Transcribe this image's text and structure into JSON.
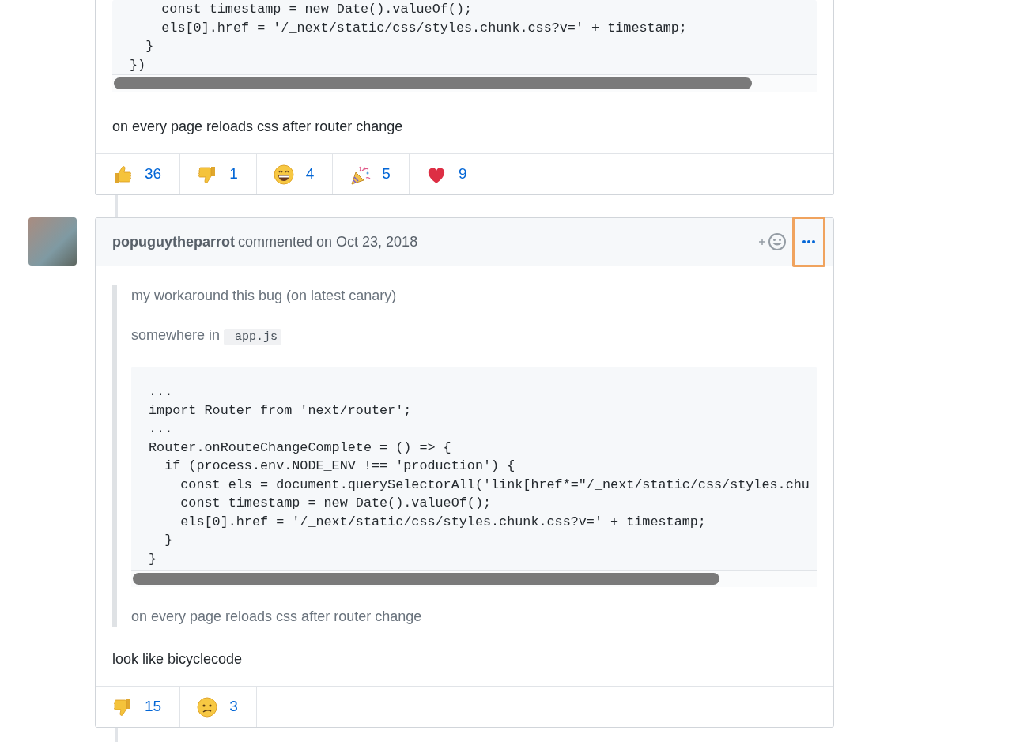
{
  "comments": [
    {
      "code_lines": [
        "    const timestamp = new Date().valueOf();",
        "    els[0].href = '/_next/static/css/styles.chunk.css?v=' + timestamp;",
        "  }",
        "})"
      ],
      "body": "on every page reloads css after router change",
      "reactions": [
        {
          "kind": "thumbs_up",
          "count": "36"
        },
        {
          "kind": "thumbs_down",
          "count": "1"
        },
        {
          "kind": "laugh",
          "count": "4"
        },
        {
          "kind": "hooray",
          "count": "5"
        },
        {
          "kind": "heart",
          "count": "9"
        }
      ]
    },
    {
      "author": "popuguytheparrot",
      "action": "commented on Oct 23, 2018",
      "menu_highlighted": true,
      "quote": [
        {
          "kind": "text",
          "text": "my workaround this bug (on latest canary)"
        },
        {
          "kind": "text_code",
          "text": "somewhere in ",
          "code": "_app.js"
        },
        {
          "kind": "code_block",
          "lines": [
            "...",
            "import Router from 'next/router';",
            "...",
            "Router.onRouteChangeComplete = () => {",
            "  if (process.env.NODE_ENV !== 'production') {",
            "    const els = document.querySelectorAll('link[href*=\"/_next/static/css/styles.chu",
            "    const timestamp = new Date().valueOf();",
            "    els[0].href = '/_next/static/css/styles.chunk.css?v=' + timestamp;",
            "  }",
            "}"
          ]
        },
        {
          "kind": "text",
          "text": "on every page reloads css after router change"
        }
      ],
      "body": "look like bicyclecode",
      "reactions": [
        {
          "kind": "thumbs_down",
          "count": "15"
        },
        {
          "kind": "confused",
          "count": "3"
        }
      ]
    }
  ]
}
